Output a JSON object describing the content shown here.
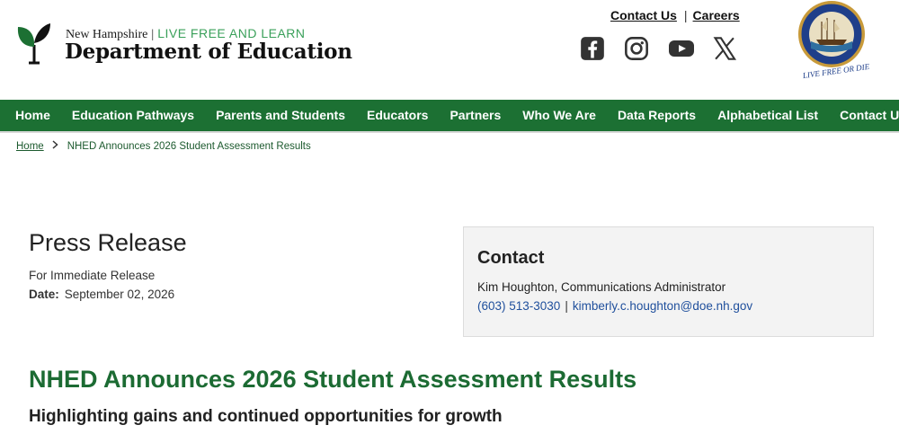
{
  "header": {
    "logo_state": "New Hampshire",
    "logo_separator": "|",
    "logo_slogan": "LIVE FREE AND LEARN",
    "logo_department": "Department of Education",
    "util_links": {
      "contact": "Contact Us",
      "separator": "|",
      "careers": "Careers"
    },
    "socials": [
      "facebook-icon",
      "instagram-icon",
      "youtube-icon",
      "x-icon"
    ],
    "seal_motto": "LIVE FREE OR DIE"
  },
  "nav": {
    "items": [
      "Home",
      "Education Pathways",
      "Parents and Students",
      "Educators",
      "Partners",
      "Who We Are",
      "Data Reports",
      "Alphabetical List",
      "Contact Us"
    ]
  },
  "breadcrumb": {
    "home": "Home",
    "current": "NHED Announces 2026 Student Assessment Results"
  },
  "press_release": {
    "title": "Press Release",
    "release_type": "For Immediate Release",
    "date_label": "Date:",
    "date_value": "September 02, 2026"
  },
  "contact": {
    "title": "Contact",
    "name": "Kim Houghton, Communications Administrator",
    "phone": "(603) 513-3030",
    "separator": "|",
    "email": "kimberly.c.houghton@doe.nh.gov"
  },
  "article": {
    "headline": "NHED Announces 2026 Student Assessment Results",
    "subheadline": "Highlighting gains and continued opportunities for growth"
  },
  "colors": {
    "brand_green": "#1c7033",
    "headline_green": "#1c6b33",
    "slogan_green": "#3aa05a",
    "link_blue": "#1f4f9c"
  }
}
